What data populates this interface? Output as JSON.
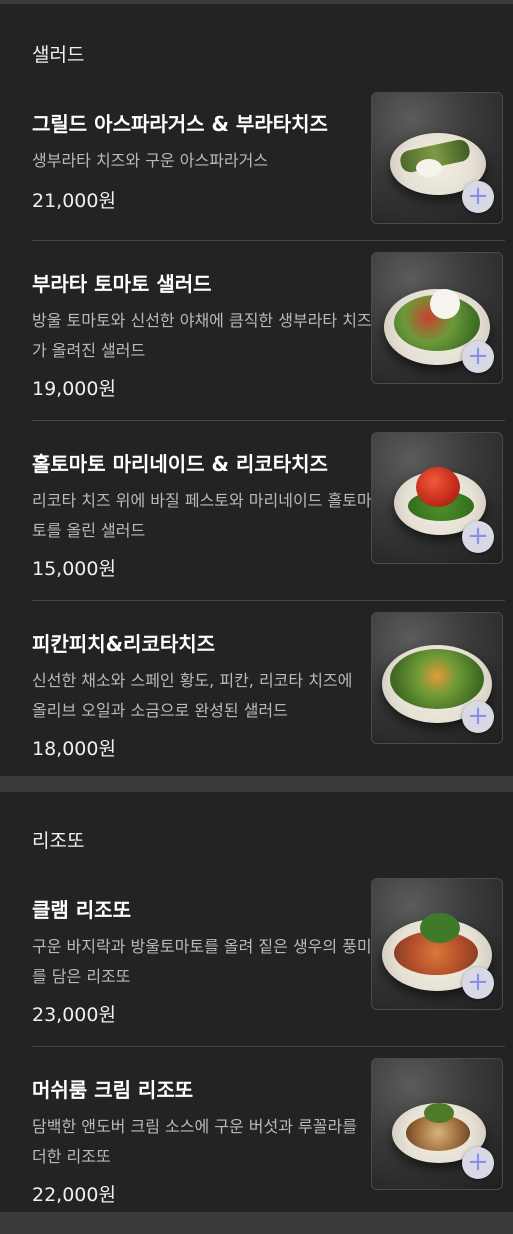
{
  "sections": [
    {
      "title": "샐러드",
      "items": [
        {
          "name": "그릴드 아스파라거스 & 부라타치즈",
          "desc": "생부라타 치즈와 구운 아스파라거스",
          "price": "21,000원",
          "image": "grilled-asparagus-burrata-photo"
        },
        {
          "name": "부라타 토마토 샐러드",
          "desc": "방울 토마토와 신선한 야채에 큼직한 생부라타 치즈가 올려진 샐러드",
          "price": "19,000원",
          "image": "burrata-tomato-salad-photo"
        },
        {
          "name": "홀토마토 마리네이드 & 리코타치즈",
          "desc": "리코타 치즈 위에 바질 페스토와 마리네이드 홀토마토를 올린 샐러드",
          "price": "15,000원",
          "image": "tomato-marinade-ricotta-photo"
        },
        {
          "name": "피칸피치&리코타치즈",
          "desc": "신선한 채소와 스페인 황도, 피칸, 리코타 치즈에 올리브 오일과 소금으로 완성된 샐러드",
          "price": "18,000원",
          "image": "pecan-peach-ricotta-photo"
        }
      ]
    },
    {
      "title": "리조또",
      "items": [
        {
          "name": "클램 리조또",
          "desc": "구운 바지락과 방울토마토를 올려 짙은 생우의 풍미를 담은 리조또",
          "price": "23,000원",
          "image": "clam-risotto-photo"
        },
        {
          "name": "머쉬룸 크림 리조또",
          "desc": "담백한 앤도버 크림 소스에 구운 버섯과 루꼴라를 더한 리조또",
          "price": "22,000원",
          "image": "mushroom-cream-risotto-photo"
        }
      ]
    }
  ],
  "add_button_label": "+"
}
